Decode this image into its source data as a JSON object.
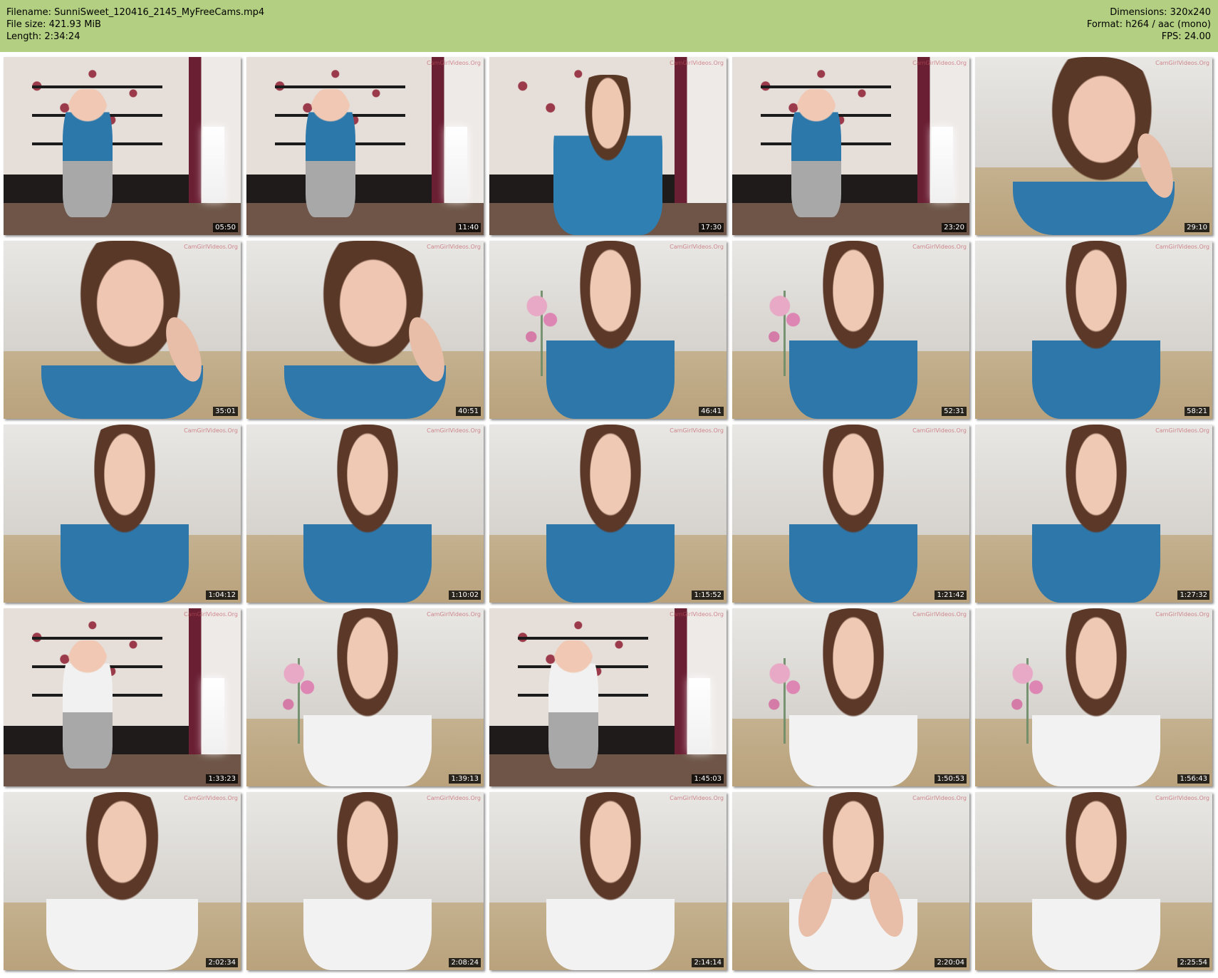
{
  "header": {
    "filename": "Filename: SunniSweet_120416_2145_MyFreeCams.mp4",
    "file_size": "File size: 421.93 MiB",
    "length": "Length: 2:34:24",
    "dimensions": "Dimensions: 320x240",
    "format": "Format: h264 / aac (mono)",
    "fps": "FPS: 24.00",
    "background_color": "#b3cf81"
  },
  "thumbnails": [
    {
      "timestamp": "05:50",
      "scene": "room-blue"
    },
    {
      "timestamp": "11:40",
      "scene": "room-blue"
    },
    {
      "timestamp": "17:30",
      "scene": "room-blue-close"
    },
    {
      "timestamp": "23:20",
      "scene": "room-blue"
    },
    {
      "timestamp": "29:10",
      "scene": "face-blue-close"
    },
    {
      "timestamp": "35:01",
      "scene": "face-blue-close"
    },
    {
      "timestamp": "40:51",
      "scene": "face-blue-close"
    },
    {
      "timestamp": "46:41",
      "scene": "portrait-blue-flowers"
    },
    {
      "timestamp": "52:31",
      "scene": "portrait-blue-flowers"
    },
    {
      "timestamp": "58:21",
      "scene": "portrait-blue"
    },
    {
      "timestamp": "1:04:12",
      "scene": "portrait-blue"
    },
    {
      "timestamp": "1:10:02",
      "scene": "portrait-blue"
    },
    {
      "timestamp": "1:15:52",
      "scene": "portrait-blue"
    },
    {
      "timestamp": "1:21:42",
      "scene": "portrait-blue"
    },
    {
      "timestamp": "1:27:32",
      "scene": "portrait-blue"
    },
    {
      "timestamp": "1:33:23",
      "scene": "room-white"
    },
    {
      "timestamp": "1:39:13",
      "scene": "portrait-white-flowers"
    },
    {
      "timestamp": "1:45:03",
      "scene": "room-white"
    },
    {
      "timestamp": "1:50:53",
      "scene": "portrait-white-flowers"
    },
    {
      "timestamp": "1:56:43",
      "scene": "portrait-white-flowers"
    },
    {
      "timestamp": "2:02:34",
      "scene": "portrait-white-close"
    },
    {
      "timestamp": "2:08:24",
      "scene": "portrait-white"
    },
    {
      "timestamp": "2:14:14",
      "scene": "portrait-white"
    },
    {
      "timestamp": "2:20:04",
      "scene": "portrait-white-hands"
    },
    {
      "timestamp": "2:25:54",
      "scene": "portrait-white"
    }
  ],
  "watermark_text": "CamGirlVideos.Org"
}
